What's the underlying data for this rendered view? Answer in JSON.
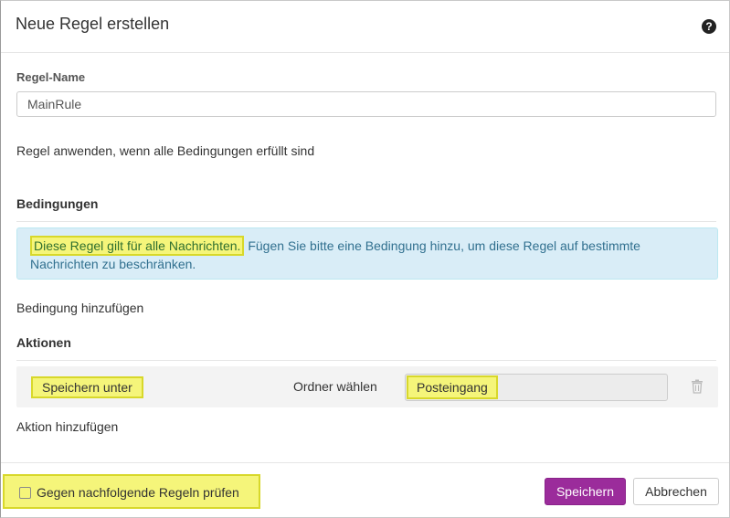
{
  "dialog": {
    "title": "Neue Regel erstellen",
    "help_icon": "question-circle-icon"
  },
  "rule_name": {
    "label": "Regel-Name",
    "value": "MainRule"
  },
  "apply_text": "Regel anwenden, wenn alle Bedingungen erfüllt sind",
  "conditions": {
    "title": "Bedingungen",
    "alert_highlight": "Diese Regel gilt für alle Nachrichten.",
    "alert_rest": " Fügen Sie bitte eine Bedingung hinzu, um diese Regel auf bestimmte Nachrichten zu beschränken.",
    "add_label": "Bedingung hinzufügen"
  },
  "actions": {
    "title": "Aktionen",
    "rows": [
      {
        "type": "Speichern unter",
        "folder_label": "Ordner wählen",
        "folder_value": "Posteingang",
        "delete_icon": "trash-icon"
      }
    ],
    "add_label": "Aktion hinzufügen"
  },
  "footer": {
    "checkbox_label": "Gegen nachfolgende Regeln prüfen",
    "checkbox_checked": false,
    "save_label": "Speichern",
    "cancel_label": "Abbrechen"
  },
  "colors": {
    "primary_button": "#9b2c9b",
    "alert_bg": "#d9edf7",
    "alert_text": "#31708f",
    "highlight": "#f5f57a"
  }
}
